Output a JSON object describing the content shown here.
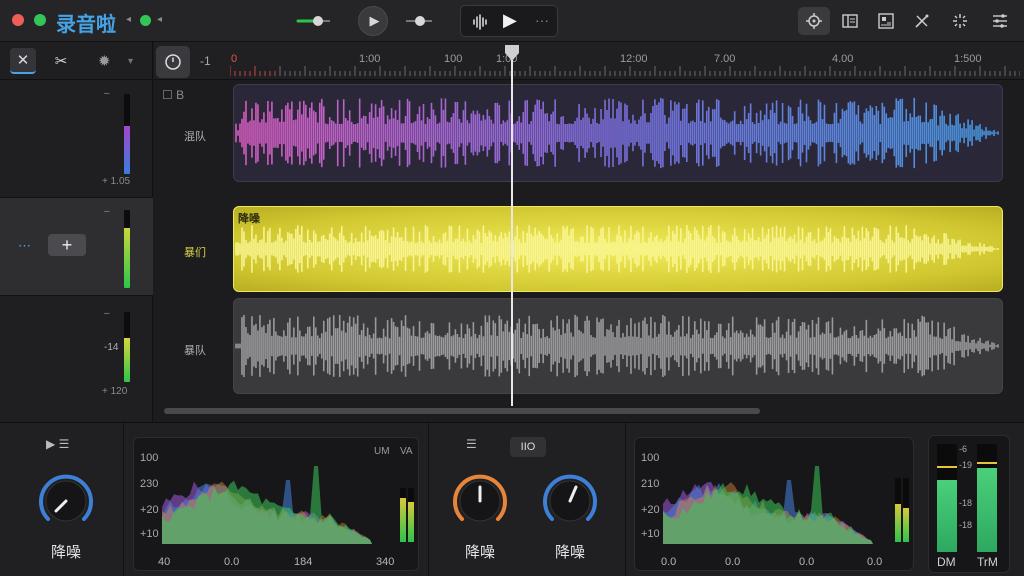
{
  "app": {
    "title": "录音啦",
    "accent": "#45a3e6"
  },
  "toolbar": {
    "play_button": "▶",
    "transport_play": "▶",
    "transport_more": "···",
    "tools": [
      "settings-icon",
      "panel-icon",
      "library-icon",
      "magic-icon",
      "spark-icon",
      "equalizer-icon"
    ]
  },
  "left_panel": {
    "tools": [
      "✕",
      "✂"
    ],
    "gear": "✹",
    "tracks": [
      {
        "top_label": "–",
        "bottom_label": "+ 1.05"
      },
      {
        "top_label": "–",
        "add": "+"
      },
      {
        "top_label": "–",
        "mid_label": "-14",
        "bottom_label": "+ 120"
      }
    ]
  },
  "timeline": {
    "minus": "-1",
    "ruler": [
      "0",
      "1:00",
      "100",
      "1:00",
      "12:00",
      "7.00",
      "4.00",
      "1:500"
    ],
    "track_b_label": "B",
    "tracks": [
      {
        "name": "混队",
        "clip_label": ""
      },
      {
        "name": "暴们",
        "clip_label": "降噪"
      },
      {
        "name": "暴队",
        "clip_label": ""
      }
    ]
  },
  "bottom": {
    "knob_left_label": "降噪",
    "left_icons": "▶ ☰",
    "spectrum1": {
      "y_labels": [
        "100",
        "230",
        "+20",
        "+10"
      ],
      "x_labels": [
        "40",
        "0.0",
        "184",
        "340"
      ],
      "top_labels": [
        "UM",
        "VA"
      ]
    },
    "mid_icons": "☰",
    "mid_tab": "IIO",
    "knob_mid1_label": "降噪",
    "knob_mid2_label": "降噪",
    "spectrum2": {
      "y_labels": [
        "100",
        "210",
        "+20",
        "+10"
      ],
      "x_labels": [
        "0.0",
        "0.0",
        "0.0",
        "0.0"
      ]
    },
    "dm": {
      "left": "DM",
      "right": "TrM",
      "scale": [
        "-6",
        "-19",
        "-18",
        "-18"
      ]
    }
  },
  "colors": {
    "clip1": "#2c2a3e",
    "clip2": "#d9d23a",
    "clip3": "#3a3a3c",
    "meter_green": "#2ec44a",
    "meter_blue": "#3a7de0"
  }
}
